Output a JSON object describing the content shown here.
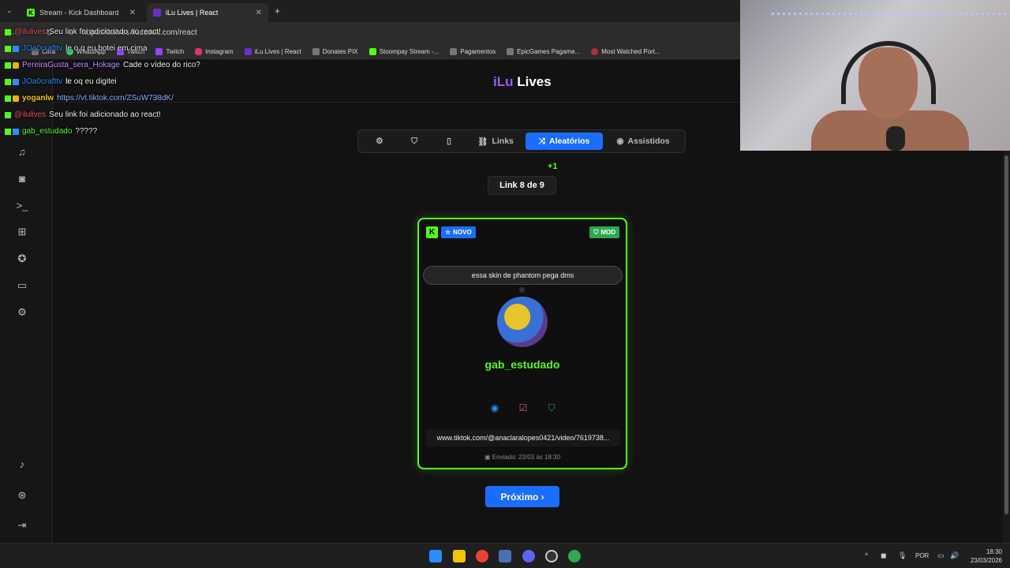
{
  "browser": {
    "tabs": [
      {
        "title": "Stream - Kick Dashboard",
        "active": false
      },
      {
        "title": "iLu Lives | React",
        "active": true
      }
    ],
    "url": "https://ilulives.ilucasus.com/react",
    "bookmarks": [
      "Cifra",
      "WhatsApp",
      "Twitch",
      "Twitch",
      "Instagram",
      "iLu Lives | React",
      "Donates PIX",
      "Stoompay Stream -...",
      "Pagamentos",
      "EpicGames Pagame...",
      "Most Watched Port..."
    ]
  },
  "chat": [
    {
      "user": "@ilulives",
      "user_color": "#e9566b",
      "text": "Seu link foi adicionado ao react!",
      "link": false
    },
    {
      "user": "JOa0crafttv",
      "user_color": "#2a8cff",
      "text": "le o q eu botei em cima",
      "link": false
    },
    {
      "user": "PereiraGusta_sera_Hokage",
      "user_color": "#c28bff",
      "text": "Cade o vídeo do rico?",
      "link": false
    },
    {
      "user": "JOa0crafttv",
      "user_color": "#2a8cff",
      "text": "le oq eu digitei",
      "link": false
    },
    {
      "user": "yoganlw",
      "user_color": "#f3c400",
      "text": "https://vt.tiktok.com/ZSuW738dK/",
      "link": true
    },
    {
      "user": "@ilulives",
      "user_color": "#e9566b",
      "text": "Seu link foi adicionado ao react!",
      "link": false
    },
    {
      "user": "gab_estudado",
      "user_color": "#53fc18",
      "text": "?????",
      "link": false
    }
  ],
  "app": {
    "logo_prefix": "iLu",
    "logo_suffix": "Lives",
    "tabs": [
      {
        "label": "",
        "icon": "gear-icon"
      },
      {
        "label": "",
        "icon": "shield-icon"
      },
      {
        "label": "",
        "icon": "bookmark-icon"
      },
      {
        "label": "Links",
        "icon": "link-icon"
      },
      {
        "label": "Aleatórios",
        "icon": "shuffle-icon",
        "active": true
      },
      {
        "label": "Assistidos",
        "icon": "eye-icon"
      }
    ],
    "plus_one": "+1",
    "counter": "Link 8 de 9",
    "card": {
      "platform_badge": "K",
      "new_badge": "NOVO",
      "mod_badge": "MOD",
      "message": "essa skin de phantom pega dms",
      "username": "gab_estudado",
      "link": "www.tiktok.com/@anaclaralopes0421/video/7619738...",
      "sent": "Enviado: 23/03 às 18:30"
    },
    "next_button": "Próximo ›"
  },
  "taskbar": {
    "language": "POR",
    "time": "18:30",
    "date": "23/03/2026"
  },
  "colors": {
    "accent_blue": "#1a6dff",
    "kick_green": "#53fc18",
    "mod_green": "#2fa84f",
    "brand_purple": "#9d5bff"
  }
}
